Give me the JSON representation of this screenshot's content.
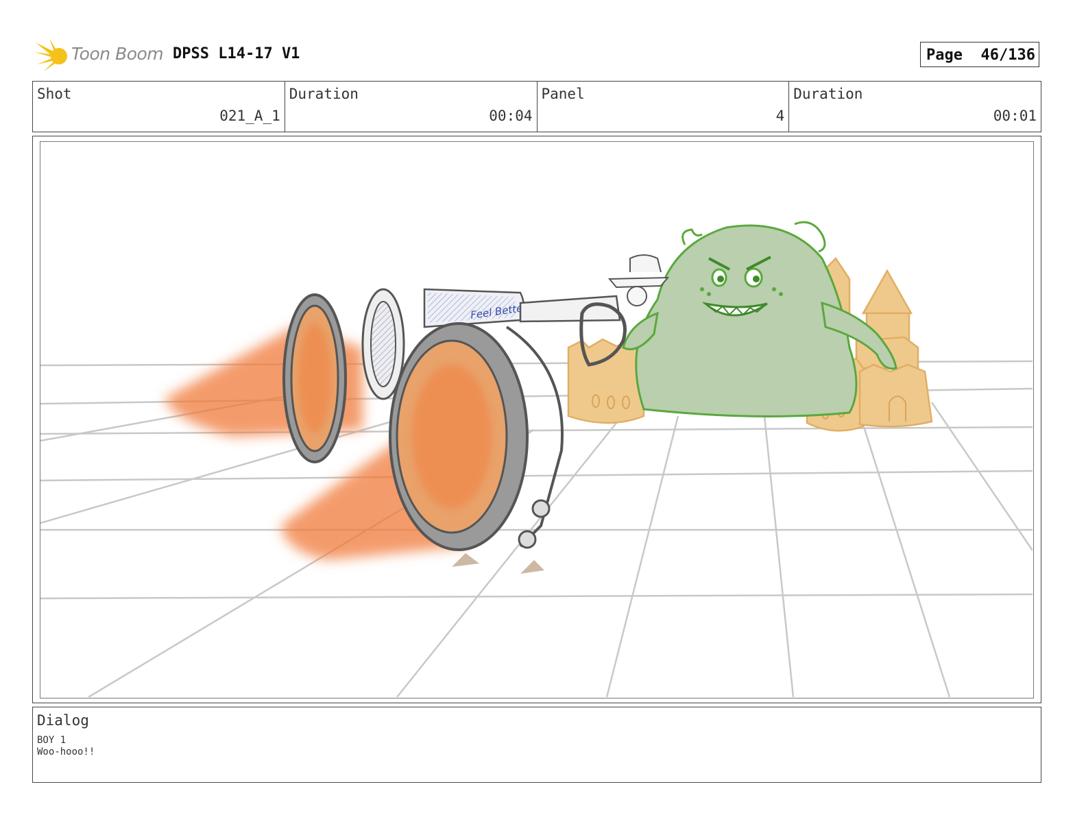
{
  "header": {
    "logo_text": "Toon Boom",
    "title": "DPSS L14-17 V1",
    "page_label": "Page",
    "page_value": "46/136"
  },
  "info": {
    "shot": {
      "label": "Shot",
      "value": "021_A_1"
    },
    "shot_duration": {
      "label": "Duration",
      "value": "00:04"
    },
    "panel": {
      "label": "Panel",
      "value": "4"
    },
    "panel_duration": {
      "label": "Duration",
      "value": "00:01"
    }
  },
  "drawing": {
    "vehicle_text": "Feel Better!"
  },
  "dialog": {
    "label": "Dialog",
    "speaker": "BOY 1",
    "line": "Woo-hooo!!"
  },
  "colors": {
    "logo_yellow": "#f4c21a",
    "monster_green": "#b9cfae",
    "monster_outline": "#5aa83c",
    "sand": "#efc98c",
    "flame": "#f07a3a",
    "grid": "#c8c8c8"
  }
}
